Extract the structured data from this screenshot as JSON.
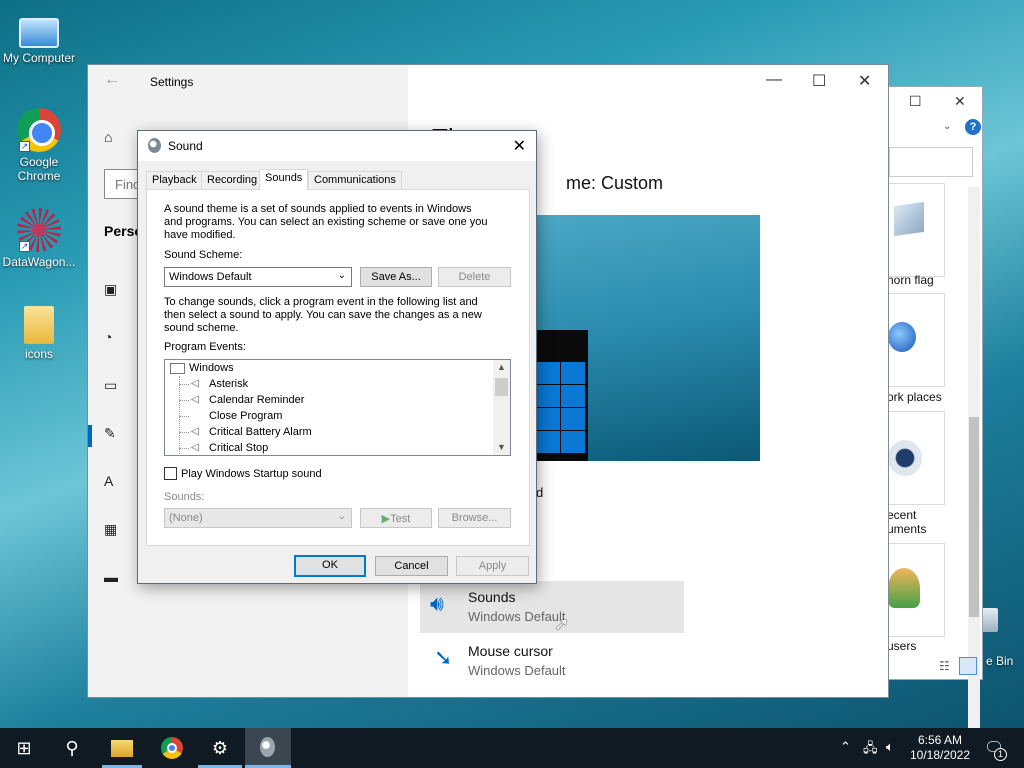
{
  "desktop": {
    "icons": [
      {
        "label": "My Computer"
      },
      {
        "label": "Google Chrome"
      },
      {
        "label": "DataWagon..."
      },
      {
        "label": "icons"
      }
    ],
    "recycle_partial": "e Bin"
  },
  "explorer_bg": {
    "items": [
      "horn flag",
      "ork places",
      "ecent",
      "uments",
      "users"
    ]
  },
  "settings": {
    "window_title": "Settings",
    "search_placeholder": "Find",
    "section": "Perso",
    "theme_heading": "Th",
    "current_theme": "me: Custom",
    "frag_d": "d",
    "items": [
      {
        "title": "Sounds",
        "value": "Windows Default"
      },
      {
        "title": "Mouse cursor",
        "value": "Windows Default"
      }
    ]
  },
  "dialog": {
    "title": "Sound",
    "tabs": [
      "Playback",
      "Recording",
      "Sounds",
      "Communications"
    ],
    "active_tab": "Sounds",
    "intro_text": [
      "A sound theme is a set of sounds applied to events in Windows",
      "and programs.  You can select an existing scheme or save one you",
      "have modified."
    ],
    "scheme_label": "Sound Scheme:",
    "scheme_value": "Windows Default",
    "save_as": "Save As...",
    "delete": "Delete",
    "change_text": [
      "To change sounds, click a program event in the following list and",
      "then select a sound to apply.  You can save the changes as a new",
      "sound scheme."
    ],
    "events_label": "Program Events:",
    "events_root": "Windows",
    "events": [
      "Asterisk",
      "Calendar Reminder",
      "Close Program",
      "Critical Battery Alarm",
      "Critical Stop"
    ],
    "startup_checkbox": "Play Windows Startup sound",
    "sounds_label": "Sounds:",
    "sounds_value": "(None)",
    "test": "Test",
    "browse": "Browse...",
    "ok": "OK",
    "cancel": "Cancel",
    "apply": "Apply"
  },
  "taskbar": {
    "time": "6:56 AM",
    "date": "10/18/2022",
    "notification_count": "1"
  }
}
